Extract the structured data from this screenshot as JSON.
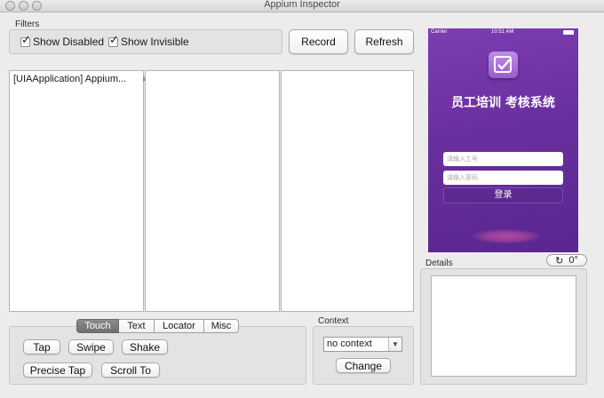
{
  "window": {
    "title": "Appium Inspector"
  },
  "filters": {
    "label": "Filters",
    "show_disabled": {
      "label": "Show Disabled",
      "checked": true
    },
    "show_invisible": {
      "label": "Show Invisible",
      "checked": true
    }
  },
  "toolbar": {
    "record_label": "Record",
    "refresh_label": "Refresh"
  },
  "tree": {
    "column1_item": "[UIAApplication] Appium...",
    "column1_item_has_children": true
  },
  "tabs": {
    "items": [
      "Touch",
      "Text",
      "Locator",
      "Misc"
    ],
    "active": "Touch"
  },
  "touch_actions": {
    "tap_label": "Tap",
    "swipe_label": "Swipe",
    "shake_label": "Shake",
    "precise_tap_label": "Precise Tap",
    "scroll_to_label": "Scroll To"
  },
  "context": {
    "label": "Context",
    "selected": "no context",
    "change_label": "Change"
  },
  "details": {
    "label": "Details",
    "rotation_value": "0°"
  },
  "device_screen": {
    "status_carrier": "Carrier",
    "status_time": "10:51 AM",
    "app_title": "员工培训 考核系统",
    "employee_id_placeholder": "请输入工号",
    "password_placeholder": "请输入密码",
    "login_label": "登录",
    "background_color": "#6a2f9e"
  },
  "icons": {
    "rotate": "rotate-icon",
    "dropdown": "chevron-down-icon",
    "disclosure": "disclosure-triangle-icon"
  }
}
